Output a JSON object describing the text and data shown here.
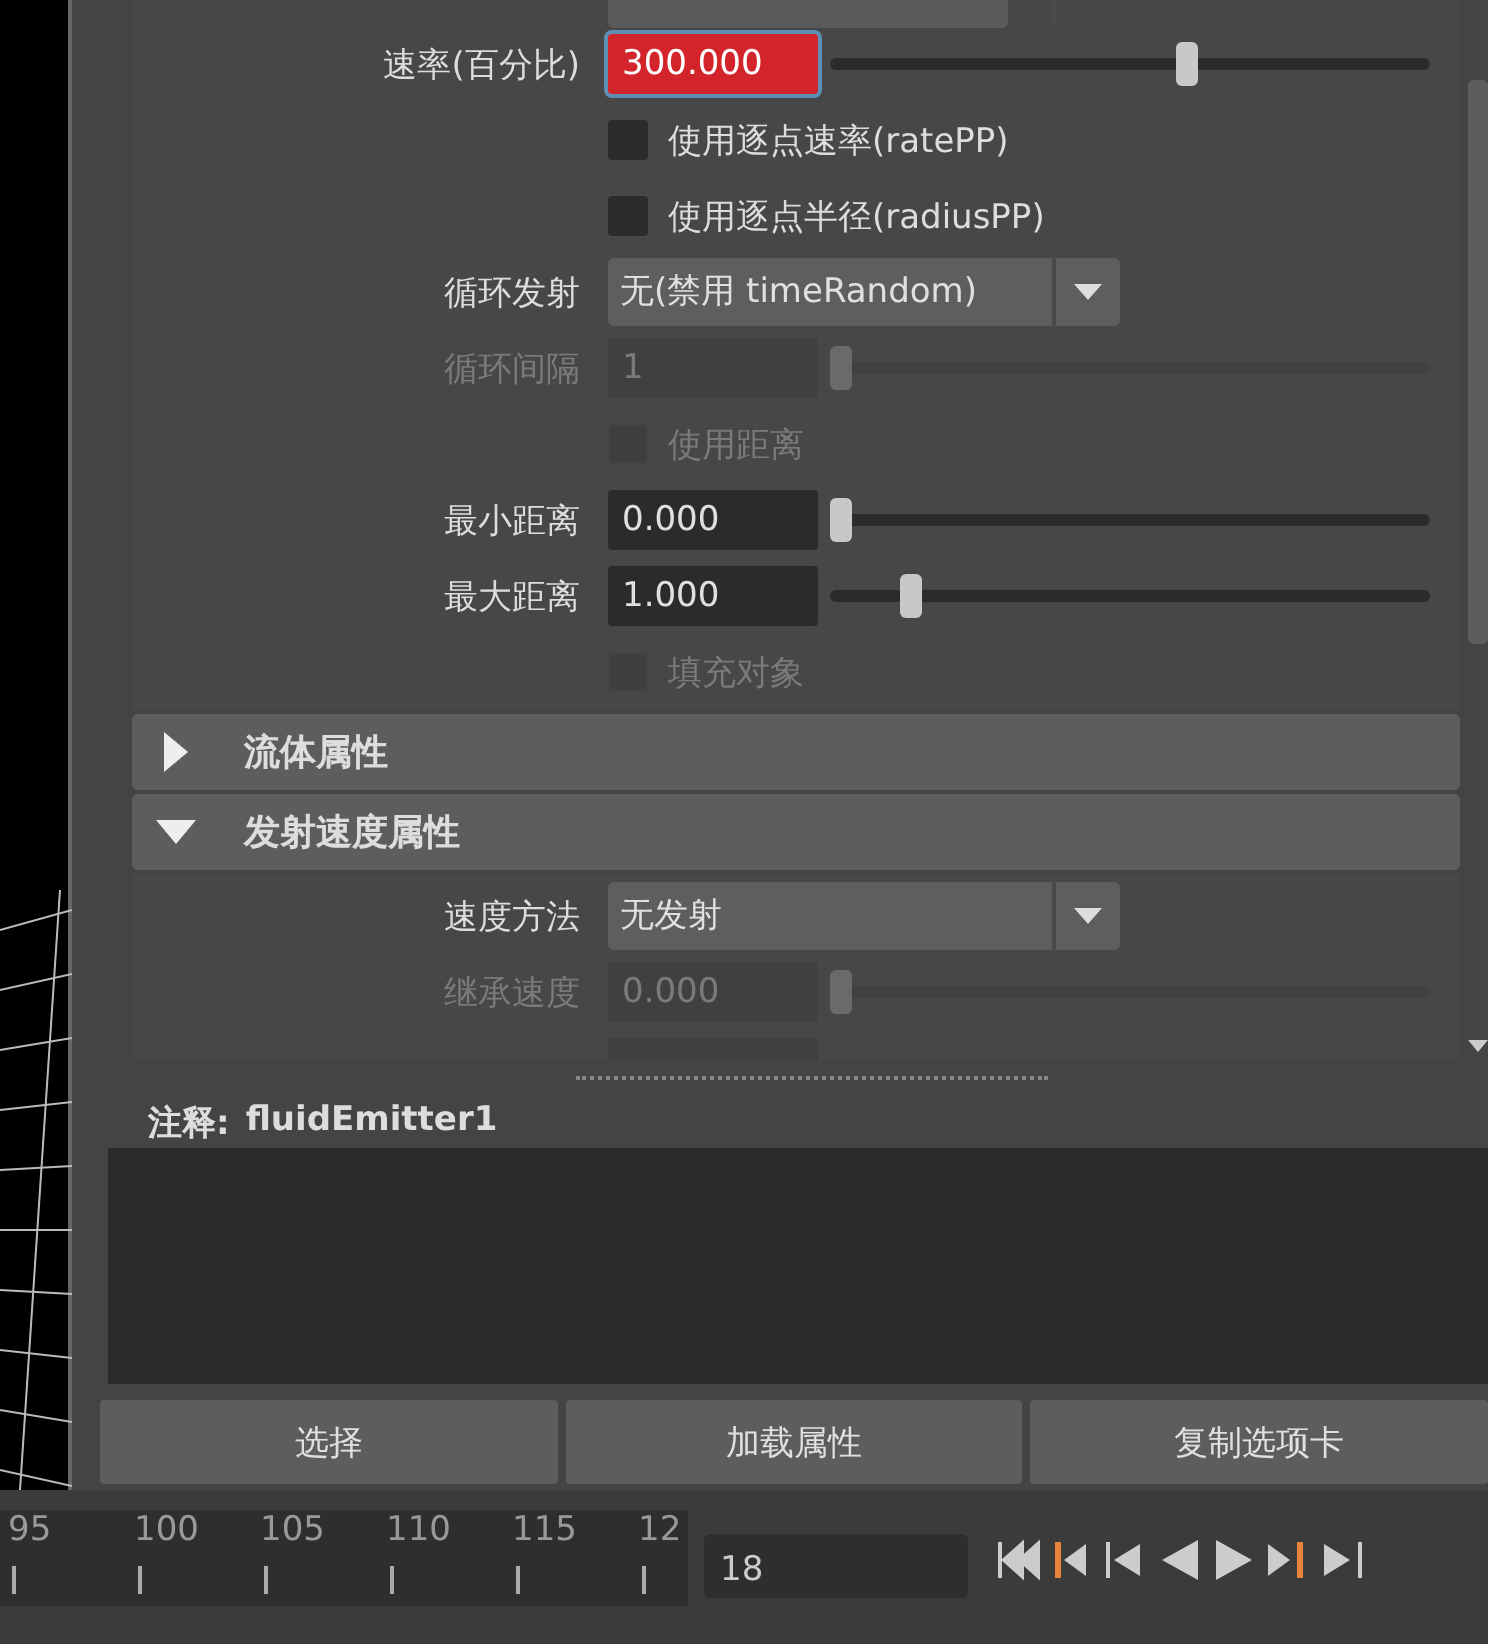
{
  "attributes": [
    {
      "kind": "field",
      "label": "速率(百分比)",
      "value": "300.000",
      "highlighted": true,
      "disabled": false,
      "level": 0.6
    },
    {
      "kind": "checkbox",
      "label": "使用逐点速率(ratePP)",
      "checked": false,
      "disabled": false
    },
    {
      "kind": "checkbox",
      "label": "使用逐点半径(radiusPP)",
      "checked": false,
      "disabled": false
    },
    {
      "kind": "dropdown",
      "label": "循环发射",
      "value": "无(禁用 timeRandom)"
    },
    {
      "kind": "field",
      "label": "循环间隔",
      "value": "1",
      "highlighted": false,
      "disabled": true,
      "level": 0
    },
    {
      "kind": "checkbox",
      "label": "使用距离",
      "checked": false,
      "disabled": true
    },
    {
      "kind": "field",
      "label": "最小距离",
      "value": "0.000",
      "highlighted": false,
      "disabled": false,
      "level": 0
    },
    {
      "kind": "field",
      "label": "最大距离",
      "value": "1.000",
      "highlighted": false,
      "disabled": false,
      "level": 0.12
    },
    {
      "kind": "checkbox",
      "label": "填充对象",
      "checked": false,
      "disabled": true
    }
  ],
  "sections": [
    {
      "title": "流体属性",
      "expanded": false
    },
    {
      "title": "发射速度属性",
      "expanded": true,
      "attributes": [
        {
          "kind": "dropdown",
          "label": "速度方法",
          "value": "无发射"
        },
        {
          "kind": "field",
          "label": "继承速度",
          "value": "0.000",
          "highlighted": false,
          "disabled": true,
          "level": 0
        }
      ]
    }
  ],
  "notes": {
    "label": "注释:",
    "node": "fluidEmitter1"
  },
  "buttons": [
    "选择",
    "加载属性",
    "复制选项卡"
  ],
  "timeline": {
    "ticks": [
      "95",
      "100",
      "105",
      "110",
      "115",
      "12"
    ],
    "current_frame": "18"
  }
}
